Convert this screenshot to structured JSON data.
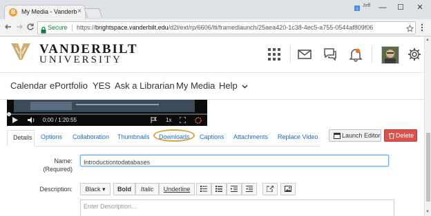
{
  "browser": {
    "tab_title": "My Media - Vanderbilt U",
    "tab_favicon_letter": "B",
    "tab_close": "×",
    "window_minimize": "—",
    "window_maximize": "☐",
    "window_close": "✕",
    "user_label": "Jeff",
    "secure_label": "Secure",
    "url_scheme": "https://",
    "url_host": "brightspace.vanderbilt.edu",
    "url_path": "/d2l/ext/rp/6606/lti/framedlaunch/25aea420-1c38-4ec5-a755-0544af809f06",
    "back_icon": "arrow-left-icon",
    "forward_icon": "arrow-right-icon",
    "reload_icon": "reload-icon",
    "bookmark_icon": "star-icon",
    "menu_icon": "kebab-icon"
  },
  "header": {
    "logo_line1": "VANDERBILT",
    "logo_line2": "UNIVERSITY",
    "brand_color": "#cfae70",
    "icons": [
      "grid-icon",
      "mail-icon",
      "chat-icon",
      "bell-icon",
      "avatar",
      "gear-icon"
    ],
    "notification_color": "#e8732c"
  },
  "nav": {
    "items": [
      "Calendar",
      "ePortfolio",
      "YES",
      "Ask a Librarian",
      "My Media",
      "Help"
    ],
    "help_caret": "⌄"
  },
  "player": {
    "time_current": "0:00",
    "time_separator": "/",
    "time_total": "1:20:55",
    "speed": "1x"
  },
  "tabs": {
    "items": [
      "Details",
      "Options",
      "Collaboration",
      "Thumbnails",
      "Downloads",
      "Captions",
      "Attachments",
      "Replace Video"
    ],
    "active": "Details",
    "highlight": "Downloads",
    "highlight_color": "#d9a53f"
  },
  "actions": {
    "launch_editor": "Launch Editor",
    "delete": "Delete",
    "delete_color": "#d9534f"
  },
  "form": {
    "name_label": "Name:",
    "required_label": "(Required)",
    "name_value": "Introductiontodatabases",
    "description_label": "Description:",
    "description_placeholder": "Enter Description...",
    "color_dropdown": "Black ▾",
    "bold": "Bold",
    "italic": "Italic",
    "underline": "Underline"
  }
}
